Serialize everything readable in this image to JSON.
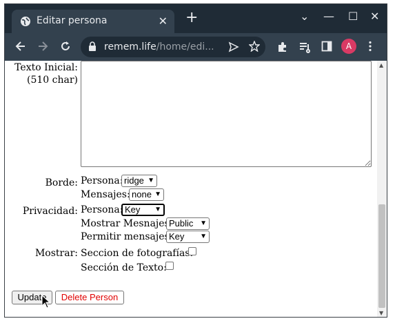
{
  "browser": {
    "tab_title": "Editar persona",
    "tab_close": "✕",
    "new_tab": "+",
    "window_controls": {
      "minimize": "—",
      "maximize": "☐",
      "close": "✕",
      "tab_search": "⌄"
    },
    "url_host": "remem.life",
    "url_path": "/home/edi...",
    "avatar_letter": "A",
    "avatar_color": "#d93a64"
  },
  "form": {
    "texto_inicial_label": "Texto Inicial:",
    "texto_inicial_hint": "(510 char)",
    "texto_inicial_value": "",
    "borde_label": "Borde:",
    "borde_persona_label": "Persona:",
    "borde_persona_value": "ridge",
    "borde_mensajes_label": "Mensajes:",
    "borde_mensajes_value": "none",
    "privacidad_label": "Privacidad:",
    "priv_persona_label": "Persona:",
    "priv_persona_value": "Key",
    "priv_mostrar_label": "Mostrar Mesnajes:",
    "priv_mostrar_value": "Public",
    "priv_permitir_label": "Permitir mensajes:",
    "priv_permitir_value": "Key",
    "mostrar_label": "Mostrar:",
    "mostrar_fotos_label": "Seccion de fotografías:",
    "mostrar_fotos_checked": false,
    "mostrar_texto_label": "Sección de Texto:",
    "mostrar_texto_checked": false,
    "update_button": "Update",
    "delete_button": "Delete Person"
  }
}
